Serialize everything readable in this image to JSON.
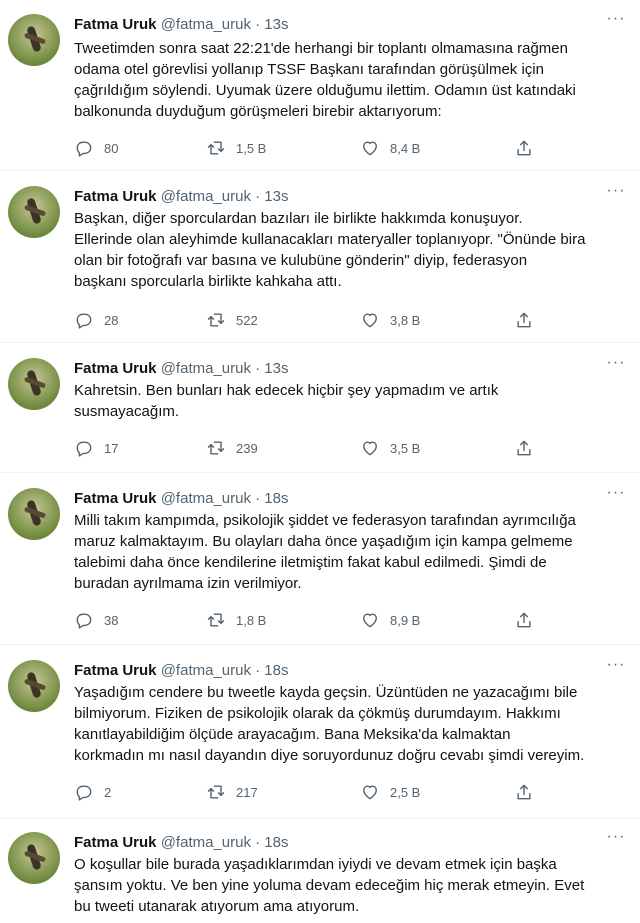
{
  "tweets": [
    {
      "name": "Fatma Uruk",
      "handle": "@fatma_uruk · 13s",
      "text": "Tweetimden sonra saat 22:21'de herhangi bir toplantı olmamasına rağmen\nodama otel görevlisi yollanıp TSSF Başkanı tarafından görüşülmek için\nçağrıldığım söylendi. Uyumak üzere olduğumu ilettim. Odamın üst katındaki\nbalkonunda duyduğum görüşmeleri birebir aktarıyorum:",
      "replies": "80",
      "retweets": "1,5 B",
      "likes": "8,4 B"
    },
    {
      "name": "Fatma Uruk",
      "handle": "@fatma_uruk · 13s",
      "text": "Başkan, diğer sporculardan bazıları ile birlikte hakkımda konuşuyor.\nEllerinde olan aleyhimde kullanacakları materyaller toplanıyopr. \"Önünde bira\nolan bir fotoğrafı var basına ve kulubüne gönderin\" diyip, federasyon\nbaşkanı sporcularla birlikte kahkaha attı.",
      "replies": "28",
      "retweets": "522",
      "likes": "3,8 B"
    },
    {
      "name": "Fatma Uruk",
      "handle": "@fatma_uruk · 13s",
      "text": "Kahretsin. Ben bunları hak edecek hiçbir şey yapmadım ve artık\nsusmayacağım.",
      "replies": "17",
      "retweets": "239",
      "likes": "3,5 B"
    },
    {
      "name": "Fatma Uruk",
      "handle": "@fatma_uruk · 18s",
      "text": "Milli takım kampımda, psikolojik şiddet ve federasyon tarafından ayrımcılığa\nmaruz kalmaktayım. Bu olayları daha önce yaşadığım için kampa gelmeme\ntalebimi daha önce kendilerine iletmiştim fakat kabul edilmedi. Şimdi de\nburadan ayrılmama izin verilmiyor.",
      "replies": "38",
      "retweets": "1,8 B",
      "likes": "8,9 B"
    },
    {
      "name": "Fatma Uruk",
      "handle": "@fatma_uruk · 18s",
      "text": "Yaşadığım cendere bu tweetle kayda geçsin. Üzüntüden ne yazacağımı bile\nbilmiyorum. Fiziken de psikolojik olarak da çökmüş durumdayım. Hakkımı\nkanıtlayabildiğim ölçüde arayacağım. Bana Meksika'da kalmaktan\nkorkmadın mı nasıl dayandın diye soruyordunuz doğru cevabı şimdi vereyim.",
      "replies": "2",
      "retweets": "217",
      "likes": "2,5 B"
    },
    {
      "name": "Fatma Uruk",
      "handle": "@fatma_uruk · 18s",
      "text": "O koşullar bile burada yaşadıklarımdan iyiydi ve devam etmek için başka\nşansım yoktu. Ve ben yine yoluma devam edeceğim hiç merak etmeyin. Evet\nbu tweeti utanarak atıyorum ama atıyorum.",
      "replies": "",
      "retweets": "",
      "likes": ""
    }
  ],
  "more_label": "···",
  "icons": {
    "reply": "reply-icon",
    "retweet": "retweet-icon",
    "like": "like-icon",
    "share": "share-icon",
    "more": "more-icon"
  }
}
